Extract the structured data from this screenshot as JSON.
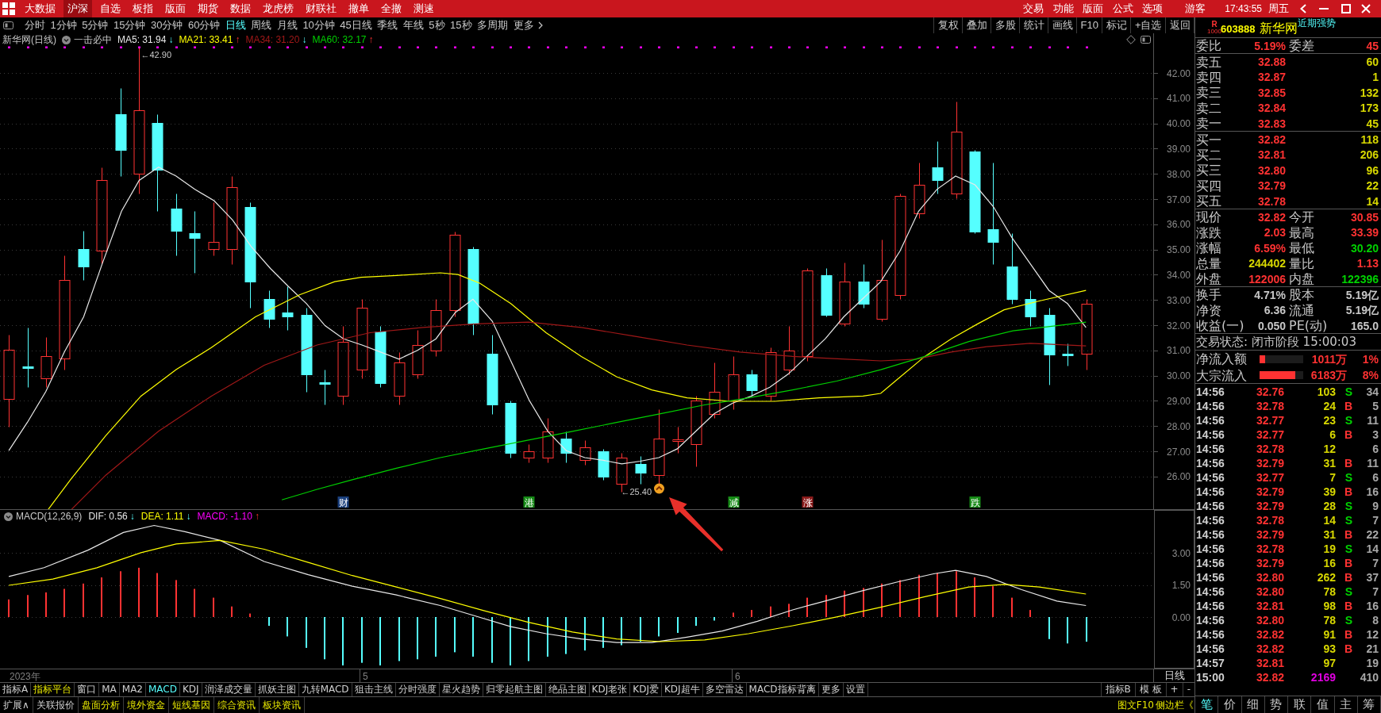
{
  "top_menu": {
    "items": [
      {
        "label": "大数据",
        "selected": false
      },
      {
        "label": "沪深",
        "selected": true
      },
      {
        "label": "自选",
        "selected": false
      },
      {
        "label": "板指",
        "selected": false
      },
      {
        "label": "版面",
        "selected": false
      },
      {
        "label": "期货",
        "selected": false
      },
      {
        "label": "数据",
        "selected": false
      },
      {
        "label": "龙虎榜",
        "selected": false
      },
      {
        "label": "财联社",
        "selected": false
      },
      {
        "label": "撤单",
        "selected": false
      },
      {
        "label": "全撤",
        "selected": false
      },
      {
        "label": "测速",
        "selected": false
      }
    ],
    "right_items": [
      "交易",
      "功能",
      "版面",
      "公式",
      "选项"
    ],
    "user": "游客",
    "time": "17:43:55",
    "weekday": "周五"
  },
  "period_bar": {
    "periods": [
      {
        "label": "分时",
        "selected": false
      },
      {
        "label": "1分钟",
        "selected": false
      },
      {
        "label": "5分钟",
        "selected": false
      },
      {
        "label": "15分钟",
        "selected": false
      },
      {
        "label": "30分钟",
        "selected": false
      },
      {
        "label": "60分钟",
        "selected": false
      },
      {
        "label": "日线",
        "selected": true
      },
      {
        "label": "周线",
        "selected": false
      },
      {
        "label": "月线",
        "selected": false
      },
      {
        "label": "10分钟",
        "selected": false
      },
      {
        "label": "45日线",
        "selected": false
      },
      {
        "label": "季线",
        "selected": false
      },
      {
        "label": "年线",
        "selected": false
      },
      {
        "label": "5秒",
        "selected": false
      },
      {
        "label": "15秒",
        "selected": false
      },
      {
        "label": "多周期",
        "selected": false
      }
    ],
    "more": "更多",
    "tools": [
      "复权",
      "叠加",
      "多股",
      "统计",
      "画线",
      "F10",
      "标记",
      "+自选",
      "返回"
    ]
  },
  "price_chart": {
    "title": "新华网(日线)",
    "formula": "一击必中",
    "ma_legend": [
      {
        "label": "MA5: 31.94",
        "arrow": "↓",
        "rising": false,
        "color": "#e8e8e8"
      },
      {
        "label": "MA21: 33.41",
        "arrow": "↑",
        "rising": true,
        "color": "#ffff00"
      },
      {
        "label": "MA34: 31.20",
        "arrow": "↓",
        "rising": false,
        "color": "#a01818"
      },
      {
        "label": "MA60: 32.17",
        "arrow": "↑",
        "rising": true,
        "color": "#00d000"
      }
    ],
    "axis_labels": [
      "42.00",
      "41.00",
      "40.00",
      "39.00",
      "38.00",
      "37.00",
      "36.00",
      "35.00",
      "34.00",
      "33.00",
      "32.00",
      "31.00",
      "30.00",
      "29.00",
      "28.00",
      "27.00",
      "26.00"
    ],
    "high_label": "←42.90",
    "low_label": "←25.40",
    "events": [
      {
        "label": "财",
        "color": "#1a3f7c"
      },
      {
        "label": "港",
        "color": "#168a16"
      },
      {
        "label": "减",
        "color": "#168a16"
      },
      {
        "label": "涨",
        "color": "#8a1a1a"
      },
      {
        "label": "跌",
        "color": "#168a16"
      }
    ]
  },
  "macd": {
    "title": "MACD(12,26,9)",
    "legend": [
      {
        "label": "DIF: 0.56",
        "arrow": "↓",
        "rising": false,
        "color": "#e8e8e8"
      },
      {
        "label": "DEA: 1.11",
        "arrow": "↓",
        "rising": false,
        "color": "#ffff00"
      },
      {
        "label": "MACD: -1.10",
        "arrow": "↑",
        "rising": true,
        "color": "#ff00ff"
      }
    ],
    "axis_labels": [
      "3.00",
      "1.50",
      "0.00"
    ]
  },
  "date_axis": {
    "labels": [
      "2023年",
      "5",
      "6"
    ],
    "period": "日线"
  },
  "indicator_tabs": [
    {
      "label": "指标A",
      "kind": "tab",
      "selected": false
    },
    {
      "label": "指标平台",
      "kind": "feature",
      "selected": false
    },
    {
      "label": "窗口",
      "kind": "tab",
      "selected": false
    },
    {
      "label": "MA",
      "kind": "tab",
      "selected": false
    },
    {
      "label": "MA2",
      "kind": "tab",
      "selected": false
    },
    {
      "label": "MACD",
      "kind": "tab",
      "selected": true
    },
    {
      "label": "KDJ",
      "kind": "tab",
      "selected": false
    },
    {
      "label": "润泽成交量",
      "kind": "tab",
      "selected": false
    },
    {
      "label": "抓妖主图",
      "kind": "tab",
      "selected": false
    },
    {
      "label": "九转MACD",
      "kind": "tab",
      "selected": false
    },
    {
      "label": "狙击主线",
      "kind": "tab",
      "selected": false
    },
    {
      "label": "分时强度",
      "kind": "tab",
      "selected": false
    },
    {
      "label": "星火趋势",
      "kind": "tab",
      "selected": false
    },
    {
      "label": "归零起航主图",
      "kind": "tab",
      "selected": false
    },
    {
      "label": "绝品主图",
      "kind": "tab",
      "selected": false
    },
    {
      "label": "KDJ老张",
      "kind": "tab",
      "selected": false
    },
    {
      "label": "KDJ爱",
      "kind": "tab",
      "selected": false
    },
    {
      "label": "KDJ超牛",
      "kind": "tab",
      "selected": false
    },
    {
      "label": "多空雷达",
      "kind": "tab",
      "selected": false
    },
    {
      "label": "MACD指标背离",
      "kind": "tab",
      "selected": false
    },
    {
      "label": "更多",
      "kind": "tab",
      "selected": false
    },
    {
      "label": "设置",
      "kind": "tab",
      "selected": false
    }
  ],
  "template_controls": [
    "指标B",
    "模 板",
    "+",
    "-"
  ],
  "bottom_links": [
    {
      "label": "扩展∧",
      "kind": "plain"
    },
    {
      "label": "关联报价",
      "kind": "plain"
    },
    {
      "label": "盘面分析",
      "kind": "feature"
    },
    {
      "label": "境外资金",
      "kind": "feature"
    },
    {
      "label": "短线基因",
      "kind": "feature"
    },
    {
      "label": "综合资讯",
      "kind": "feature"
    },
    {
      "label": "板块资讯",
      "kind": "feature"
    }
  ],
  "side_links": [
    "图文F10",
    "侧边栏《"
  ],
  "quote": {
    "flag_letter": "R",
    "flag_number": "1000",
    "code": "603888",
    "name": "新华网",
    "tag": "近期强势",
    "summary": [
      {
        "label": "委比",
        "value": "5.19%"
      },
      {
        "label": "委差",
        "value": "45"
      }
    ],
    "asks": [
      {
        "label": "卖五",
        "price": "32.88",
        "volume": "60"
      },
      {
        "label": "卖四",
        "price": "32.87",
        "volume": "1"
      },
      {
        "label": "卖三",
        "price": "32.85",
        "volume": "132"
      },
      {
        "label": "卖二",
        "price": "32.84",
        "volume": "173"
      },
      {
        "label": "卖一",
        "price": "32.83",
        "volume": "45"
      }
    ],
    "bids": [
      {
        "label": "买一",
        "price": "32.82",
        "volume": "118"
      },
      {
        "label": "买二",
        "price": "32.81",
        "volume": "206"
      },
      {
        "label": "买三",
        "price": "32.80",
        "volume": "96"
      },
      {
        "label": "买四",
        "price": "32.79",
        "volume": "22"
      },
      {
        "label": "买五",
        "price": "32.78",
        "volume": "14"
      }
    ],
    "stats": [
      {
        "label": "现价",
        "value": "32.82",
        "color": "#ff3232"
      },
      {
        "label": "今开",
        "value": "30.85",
        "color": "#ff3232"
      },
      {
        "label": "涨跌",
        "value": "2.03",
        "color": "#ff3232"
      },
      {
        "label": "最高",
        "value": "33.39",
        "color": "#ff3232"
      },
      {
        "label": "涨幅",
        "value": "6.59%",
        "color": "#ff3232"
      },
      {
        "label": "最低",
        "value": "30.20",
        "color": "#00d200"
      },
      {
        "label": "总量",
        "value": "244402",
        "color": "#d8d800"
      },
      {
        "label": "量比",
        "value": "1.13",
        "color": "#ff3232"
      },
      {
        "label": "外盘",
        "value": "122006",
        "color": "#ff3232"
      },
      {
        "label": "内盘",
        "value": "122396",
        "color": "#00d200"
      }
    ],
    "fundamentals": [
      {
        "label": "换手",
        "value": "4.71%"
      },
      {
        "label": "股本",
        "value": "5.19亿"
      },
      {
        "label": "净资",
        "value": "6.36"
      },
      {
        "label": "流通",
        "value": "5.19亿"
      },
      {
        "label": "收益(一)",
        "value": "0.050"
      },
      {
        "label": "PE(动)",
        "value": "165.0"
      }
    ],
    "status": "交易状态: 闭市阶段 15:00:03",
    "flows": [
      {
        "label": "净流入额",
        "level": 0.12,
        "amount": "1011万",
        "percent": "1%"
      },
      {
        "label": "大宗流入",
        "level": 0.81,
        "amount": "6183万",
        "percent": "8%"
      }
    ],
    "ticks": [
      {
        "time": "14:56",
        "price": "32.76",
        "volume": "103",
        "side": {
          "label": "S",
          "kind": "sell"
        },
        "count": "34",
        "highlight": false
      },
      {
        "time": "14:56",
        "price": "32.78",
        "volume": "24",
        "side": {
          "label": "B",
          "kind": "buy"
        },
        "count": "5",
        "highlight": false
      },
      {
        "time": "14:56",
        "price": "32.77",
        "volume": "23",
        "side": {
          "label": "S",
          "kind": "sell"
        },
        "count": "11",
        "highlight": false
      },
      {
        "time": "14:56",
        "price": "32.77",
        "volume": "6",
        "side": {
          "label": "B",
          "kind": "buy"
        },
        "count": "3",
        "highlight": false
      },
      {
        "time": "14:56",
        "price": "32.78",
        "volume": "12",
        "count": "6",
        "highlight": false
      },
      {
        "time": "14:56",
        "price": "32.79",
        "volume": "31",
        "side": {
          "label": "B",
          "kind": "buy"
        },
        "count": "11",
        "highlight": false
      },
      {
        "time": "14:56",
        "price": "32.77",
        "volume": "7",
        "side": {
          "label": "S",
          "kind": "sell"
        },
        "count": "6",
        "highlight": false
      },
      {
        "time": "14:56",
        "price": "32.79",
        "volume": "39",
        "side": {
          "label": "B",
          "kind": "buy"
        },
        "count": "16",
        "highlight": false
      },
      {
        "time": "14:56",
        "price": "32.79",
        "volume": "28",
        "side": {
          "label": "S",
          "kind": "sell"
        },
        "count": "9",
        "highlight": false
      },
      {
        "time": "14:56",
        "price": "32.78",
        "volume": "14",
        "side": {
          "label": "S",
          "kind": "sell"
        },
        "count": "7",
        "highlight": false
      },
      {
        "time": "14:56",
        "price": "32.79",
        "volume": "31",
        "side": {
          "label": "B",
          "kind": "buy"
        },
        "count": "22",
        "highlight": false
      },
      {
        "time": "14:56",
        "price": "32.78",
        "volume": "19",
        "side": {
          "label": "S",
          "kind": "sell"
        },
        "count": "14",
        "highlight": false
      },
      {
        "time": "14:56",
        "price": "32.79",
        "volume": "16",
        "side": {
          "label": "B",
          "kind": "buy"
        },
        "count": "7",
        "highlight": false
      },
      {
        "time": "14:56",
        "price": "32.80",
        "volume": "262",
        "side": {
          "label": "B",
          "kind": "buy"
        },
        "count": "37",
        "highlight": false
      },
      {
        "time": "14:56",
        "price": "32.80",
        "volume": "78",
        "side": {
          "label": "S",
          "kind": "sell"
        },
        "count": "7",
        "highlight": false
      },
      {
        "time": "14:56",
        "price": "32.81",
        "volume": "98",
        "side": {
          "label": "B",
          "kind": "buy"
        },
        "count": "16",
        "highlight": false
      },
      {
        "time": "14:56",
        "price": "32.80",
        "volume": "78",
        "side": {
          "label": "S",
          "kind": "sell"
        },
        "count": "8",
        "highlight": false
      },
      {
        "time": "14:56",
        "price": "32.82",
        "volume": "91",
        "side": {
          "label": "B",
          "kind": "buy"
        },
        "count": "12",
        "highlight": false
      },
      {
        "time": "14:56",
        "price": "32.82",
        "volume": "93",
        "side": {
          "label": "B",
          "kind": "buy"
        },
        "count": "21",
        "highlight": false
      },
      {
        "time": "14:57",
        "price": "32.81",
        "volume": "97",
        "count": "19",
        "highlight": false
      },
      {
        "time": "15:00",
        "price": "32.82",
        "volume": "2169",
        "count": "410",
        "highlight": true
      }
    ],
    "tabs": [
      {
        "label": "笔",
        "selected": true
      },
      {
        "label": "价",
        "selected": false
      },
      {
        "label": "细",
        "selected": false
      },
      {
        "label": "势",
        "selected": false
      },
      {
        "label": "联",
        "selected": false
      },
      {
        "label": "值",
        "selected": false
      },
      {
        "label": "主",
        "selected": false
      },
      {
        "label": "筹",
        "selected": false
      }
    ]
  }
}
